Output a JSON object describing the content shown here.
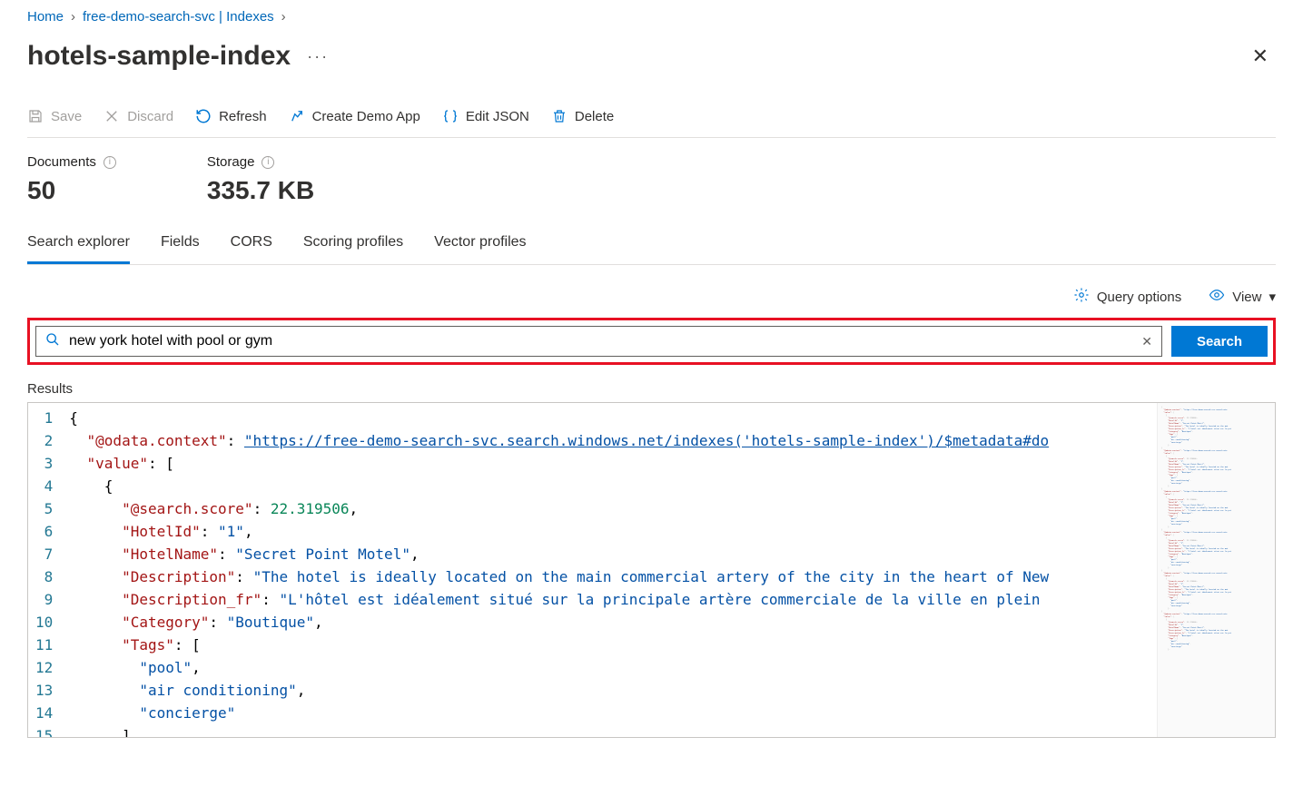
{
  "breadcrumb": {
    "home": "Home",
    "svc": "free-demo-search-svc | Indexes"
  },
  "title": "hotels-sample-index",
  "toolbar": {
    "save": "Save",
    "discard": "Discard",
    "refresh": "Refresh",
    "demo": "Create Demo App",
    "editjson": "Edit JSON",
    "delete": "Delete"
  },
  "stats": {
    "docs_label": "Documents",
    "docs_val": "50",
    "storage_label": "Storage",
    "storage_val": "335.7 KB"
  },
  "tabs": [
    "Search explorer",
    "Fields",
    "CORS",
    "Scoring profiles",
    "Vector profiles"
  ],
  "options": {
    "query": "Query options",
    "view": "View"
  },
  "search": {
    "query": "new york hotel with pool or gym",
    "button": "Search"
  },
  "results": {
    "label": "Results",
    "lines": [
      [
        [
          "pun",
          "{"
        ]
      ],
      [
        [
          "pun",
          "  "
        ],
        [
          "key",
          "\"@odata.context\""
        ],
        [
          "pun",
          ": "
        ],
        [
          "lnk",
          "\"https://free-demo-search-svc.search.windows.net/indexes('hotels-sample-index')/$metadata#do"
        ]
      ],
      [
        [
          "pun",
          "  "
        ],
        [
          "key",
          "\"value\""
        ],
        [
          "pun",
          ": ["
        ]
      ],
      [
        [
          "pun",
          "    {"
        ]
      ],
      [
        [
          "pun",
          "      "
        ],
        [
          "key",
          "\"@search.score\""
        ],
        [
          "pun",
          ": "
        ],
        [
          "num",
          "22.319506"
        ],
        [
          "pun",
          ","
        ]
      ],
      [
        [
          "pun",
          "      "
        ],
        [
          "key",
          "\"HotelId\""
        ],
        [
          "pun",
          ": "
        ],
        [
          "str",
          "\"1\""
        ],
        [
          "pun",
          ","
        ]
      ],
      [
        [
          "pun",
          "      "
        ],
        [
          "key",
          "\"HotelName\""
        ],
        [
          "pun",
          ": "
        ],
        [
          "str",
          "\"Secret Point Motel\""
        ],
        [
          "pun",
          ","
        ]
      ],
      [
        [
          "pun",
          "      "
        ],
        [
          "key",
          "\"Description\""
        ],
        [
          "pun",
          ": "
        ],
        [
          "str",
          "\"The hotel is ideally located on the main commercial artery of the city in the heart of New"
        ]
      ],
      [
        [
          "pun",
          "      "
        ],
        [
          "key",
          "\"Description_fr\""
        ],
        [
          "pun",
          ": "
        ],
        [
          "str",
          "\"L'hôtel est idéalement situé sur la principale artère commerciale de la ville en plein"
        ]
      ],
      [
        [
          "pun",
          "      "
        ],
        [
          "key",
          "\"Category\""
        ],
        [
          "pun",
          ": "
        ],
        [
          "str",
          "\"Boutique\""
        ],
        [
          "pun",
          ","
        ]
      ],
      [
        [
          "pun",
          "      "
        ],
        [
          "key",
          "\"Tags\""
        ],
        [
          "pun",
          ": ["
        ]
      ],
      [
        [
          "pun",
          "        "
        ],
        [
          "str",
          "\"pool\""
        ],
        [
          "pun",
          ","
        ]
      ],
      [
        [
          "pun",
          "        "
        ],
        [
          "str",
          "\"air conditioning\""
        ],
        [
          "pun",
          ","
        ]
      ],
      [
        [
          "pun",
          "        "
        ],
        [
          "str",
          "\"concierge\""
        ]
      ],
      [
        [
          "pun",
          "      ],"
        ]
      ]
    ]
  }
}
